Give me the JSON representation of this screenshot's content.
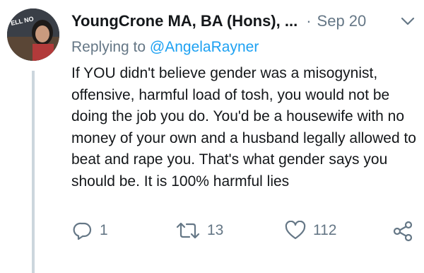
{
  "tweet": {
    "display_name": "YoungCrone MA, BA (Hons), ...",
    "separator": "·",
    "date": "Sep 20",
    "reply_prefix": "Replying to ",
    "reply_handle": "@AngelaRayner",
    "text": "If YOU didn't believe gender was a misogynist, offensive, harmful load of tosh, you would not be doing the job you do. You'd be a housewife with no money of your own and a husband legally allowed to beat and rape you. That's what gender says you should be. It is 100% harmful lies",
    "avatar_label": "ELL NO"
  },
  "actions": {
    "reply_count": "1",
    "retweet_count": "13",
    "like_count": "112"
  },
  "icons": {
    "reply": "reply-icon",
    "retweet": "retweet-icon",
    "like": "heart-icon",
    "share": "share-icon",
    "menu": "chevron-down-icon"
  },
  "colors": {
    "text": "#14171a",
    "secondary": "#657786",
    "link": "#1da1f2",
    "thread_line": "#ccd6dd"
  }
}
